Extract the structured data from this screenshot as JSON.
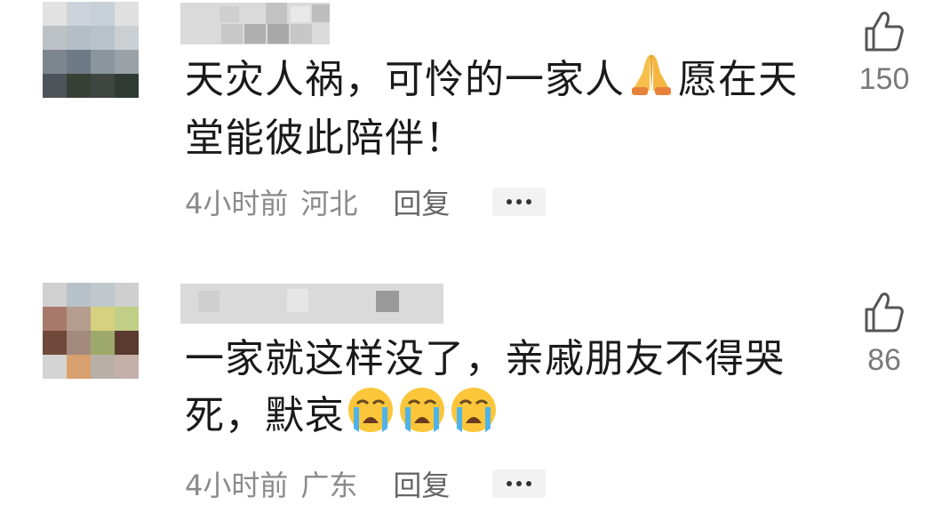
{
  "comments": [
    {
      "text_parts": [
        "天灾人祸，可怜的一家人",
        "愿在天堂能彼此陪伴！"
      ],
      "emoji": "folded-hands",
      "time": "4小时前",
      "location": "河北",
      "reply_label": "回复",
      "likes": "150",
      "avatar_colors": [
        "#e2e2e2",
        "#cdd3da",
        "#c7d0d8",
        "#e0e0e0",
        "#bcc1c6",
        "#b5bec6",
        "#b8c2cb",
        "#c9cfd3",
        "#7d868f",
        "#6e7b86",
        "#8a959e",
        "#9aa2a8",
        "#4d5358",
        "#384035",
        "#3d4640",
        "#2e3a32"
      ]
    },
    {
      "text_parts": [
        "一家就这样没了，亲戚朋友不得哭死，默哀"
      ],
      "emoji": "loudly-crying-face",
      "emoji_count": 3,
      "time": "4小时前",
      "location": "广东",
      "reply_label": "回复",
      "likes": "86",
      "avatar_colors": [
        "#d0d0d0",
        "#b7c2c8",
        "#c0c8cc",
        "#cfcfcf",
        "#a8796a",
        "#b59d8f",
        "#d6d17e",
        "#c1ce86",
        "#6f4a3a",
        "#a48a7c",
        "#9da96a",
        "#5a3a2e",
        "#d4d4d4",
        "#d9a06f",
        "#b8b0a6",
        "#c4b0a8"
      ]
    }
  ],
  "more_icon": "ellipsis-icon",
  "like_icon": "thumbs-up-icon"
}
